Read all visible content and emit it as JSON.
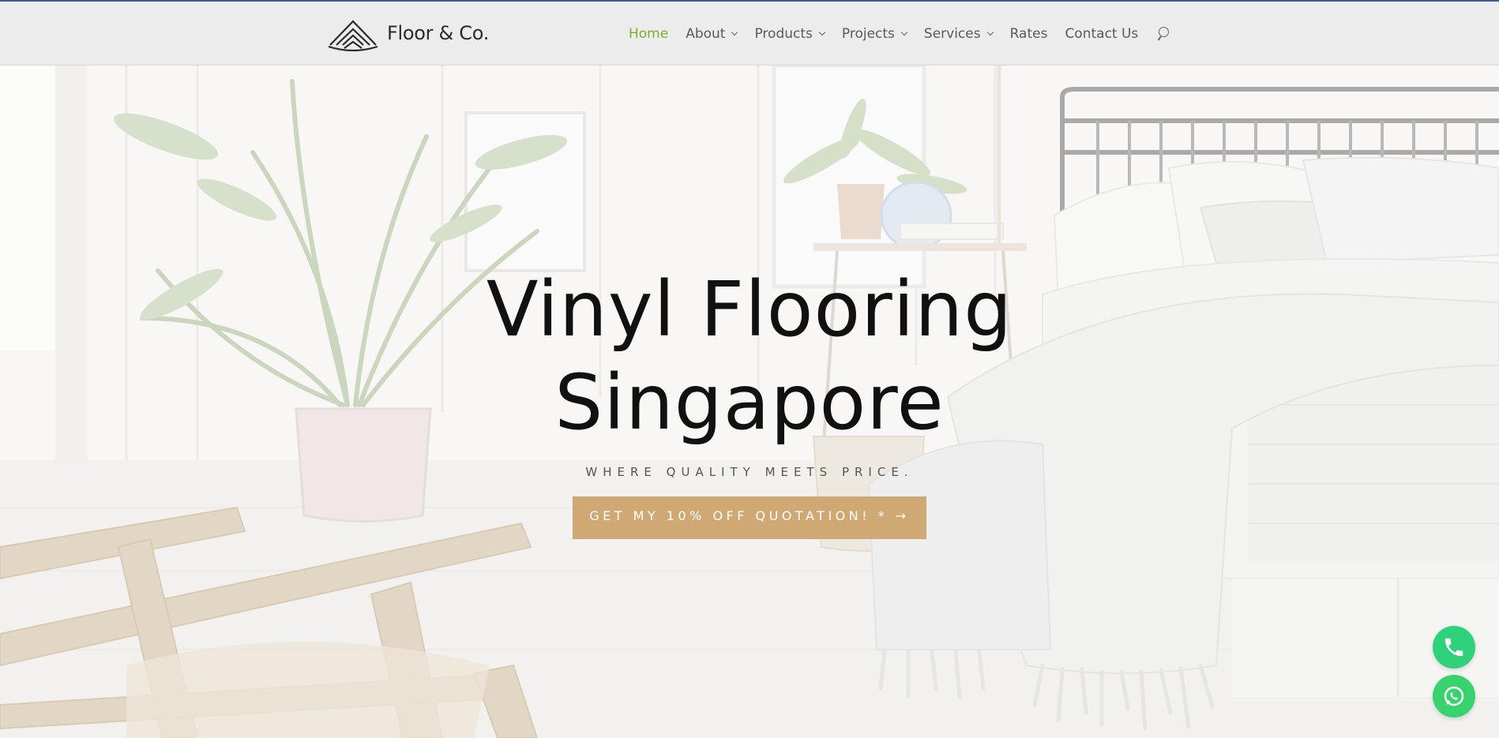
{
  "brand": {
    "name": "Floor & Co."
  },
  "nav": {
    "items": [
      {
        "label": "Home",
        "active": true,
        "has_dropdown": false
      },
      {
        "label": "About",
        "active": false,
        "has_dropdown": true
      },
      {
        "label": "Products",
        "active": false,
        "has_dropdown": true
      },
      {
        "label": "Projects",
        "active": false,
        "has_dropdown": true
      },
      {
        "label": "Services",
        "active": false,
        "has_dropdown": true
      },
      {
        "label": "Rates",
        "active": false,
        "has_dropdown": false
      },
      {
        "label": "Contact Us",
        "active": false,
        "has_dropdown": false
      }
    ],
    "search_icon": "search-icon"
  },
  "hero": {
    "title_line1": "Vinyl Flooring",
    "title_line2": "Singapore",
    "subtitle": "WHERE QUALITY MEETS PRICE.",
    "cta_label": "GET MY 10% OFF QUOTATION! * →"
  },
  "floating": {
    "phone_icon": "phone-icon",
    "whatsapp_icon": "whatsapp-icon"
  },
  "colors": {
    "accent_green": "#7ab02d",
    "cta_tan": "#cfa874",
    "float_green": "#2fd27a"
  }
}
